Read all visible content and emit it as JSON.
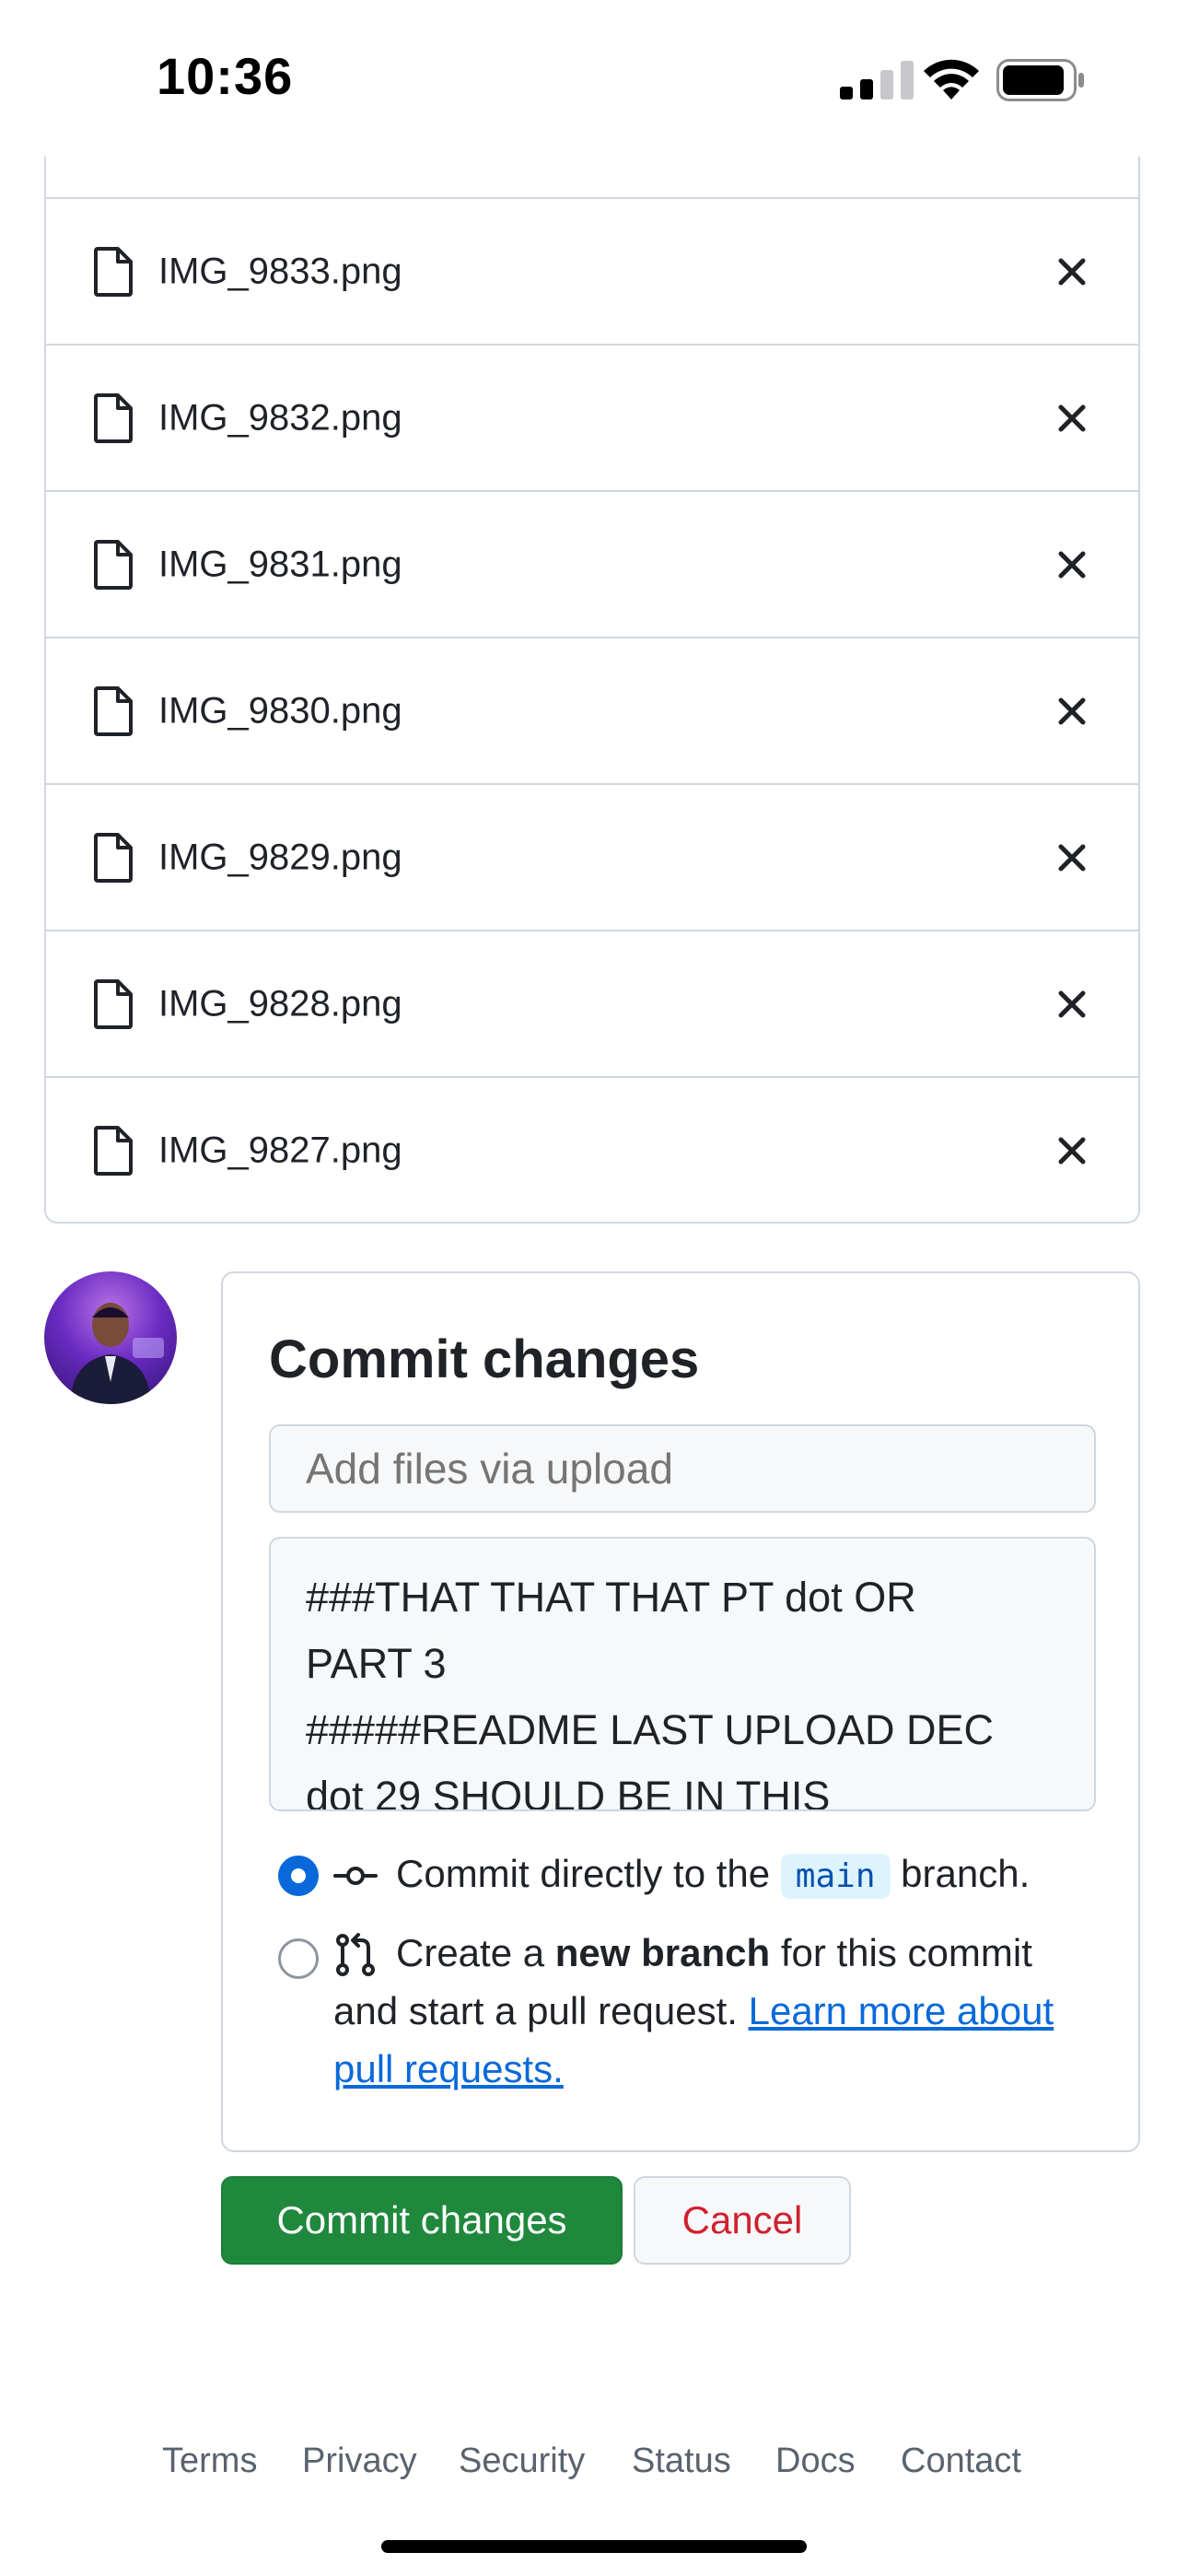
{
  "status_bar": {
    "time": "10:36"
  },
  "files": [
    {
      "name": "IMG_9833.png"
    },
    {
      "name": "IMG_9832.png"
    },
    {
      "name": "IMG_9831.png"
    },
    {
      "name": "IMG_9830.png"
    },
    {
      "name": "IMG_9829.png"
    },
    {
      "name": "IMG_9828.png"
    },
    {
      "name": "IMG_9827.png"
    }
  ],
  "commit": {
    "title": "Commit changes",
    "summary_placeholder": "Add files via upload",
    "description_lines": [
      "###THAT THAT THAT PT dot OR",
      "PART 3",
      "#####README LAST UPLOAD DEC",
      "dot 29 SHOULD BE IN THIS"
    ],
    "option_direct": {
      "prefix": "Commit directly to the",
      "branch": "main",
      "suffix": "branch."
    },
    "option_new": {
      "line1_prefix": "Create a",
      "line1_bold": "new branch",
      "line1_suffix": "for this commit",
      "line2": "and start a pull request.",
      "link_part1": "Learn more about",
      "link_part2": "pull requests."
    },
    "commit_button": "Commit changes",
    "cancel_button": "Cancel"
  },
  "footer": {
    "links": [
      "Terms",
      "Privacy",
      "Security",
      "Status",
      "Docs",
      "Contact"
    ]
  },
  "colors": {
    "primary_green": "#1f883d",
    "link_blue": "#0969da",
    "danger_red": "#cf222e",
    "border": "#d0d7de"
  }
}
